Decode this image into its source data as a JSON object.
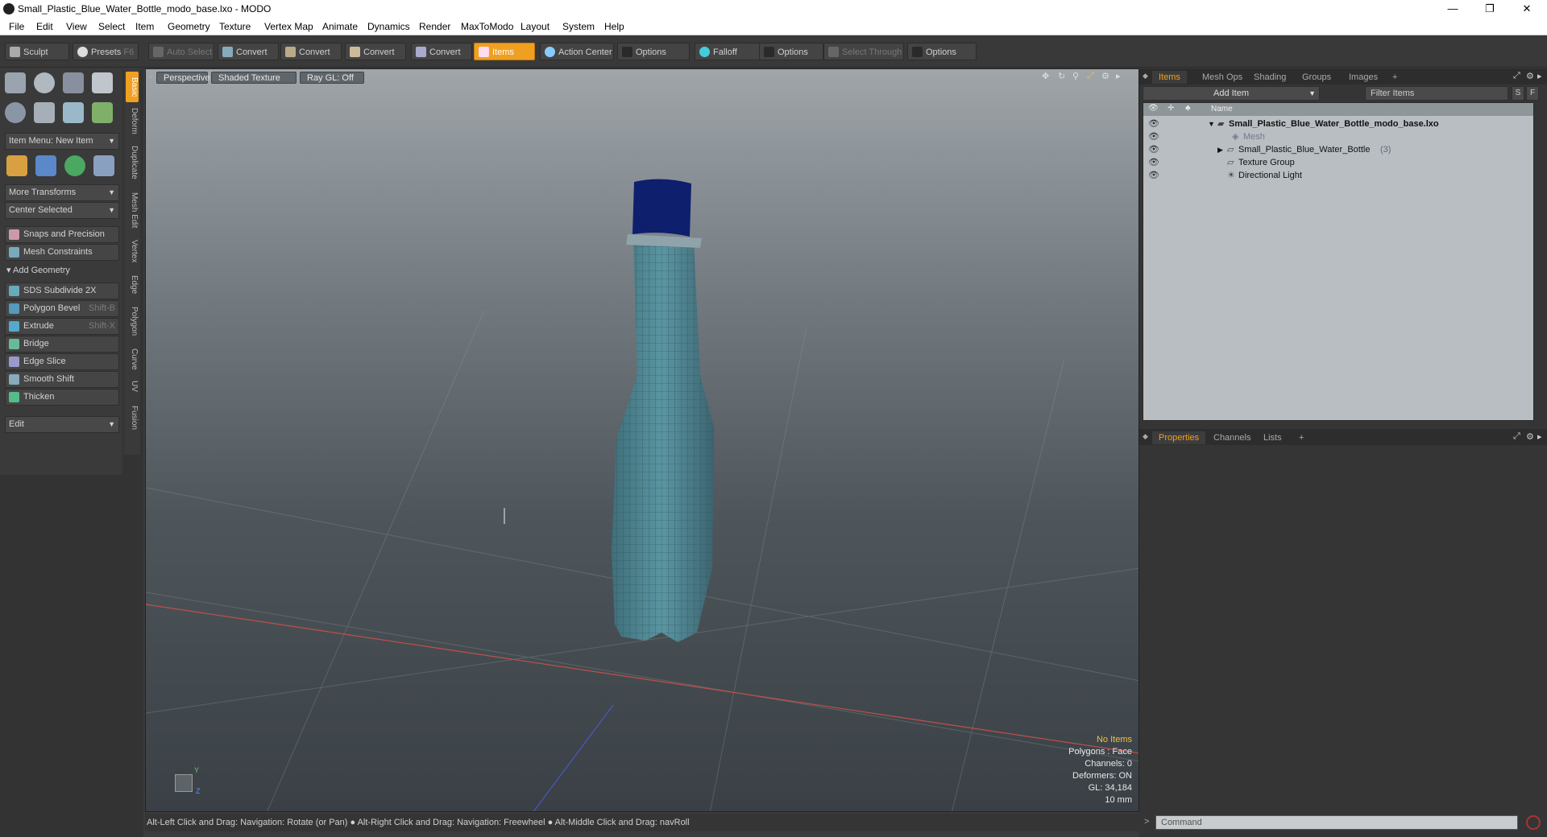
{
  "window": {
    "title": "Small_Plastic_Blue_Water_Bottle_modo_base.lxo - MODO",
    "minimize": "—",
    "restore": "❐",
    "close": "✕"
  },
  "menu": [
    "File",
    "Edit",
    "View",
    "Select",
    "Item",
    "Geometry",
    "Texture",
    "Vertex Map",
    "Animate",
    "Dynamics",
    "Render",
    "MaxToModo",
    "Layout",
    "System",
    "Help"
  ],
  "toolbar": {
    "sculpt": "Sculpt",
    "presets": "Presets",
    "presets_key": "F6",
    "auto_select": "Auto Select",
    "convert": "Convert",
    "items": "Items",
    "action_center": "Action Center",
    "options": "Options",
    "falloff": "Falloff",
    "select_through": "Select Through"
  },
  "left": {
    "item_menu": "Item Menu: New Item",
    "more_transforms": "More Transforms",
    "center_selected": "Center Selected",
    "snaps": "Snaps and Precision",
    "mesh_constraints": "Mesh Constraints",
    "add_geometry": "Add Geometry",
    "tools": [
      {
        "label": "SDS Subdivide 2X",
        "key": ""
      },
      {
        "label": "Polygon Bevel",
        "key": "Shift-B"
      },
      {
        "label": "Extrude",
        "key": "Shift-X"
      },
      {
        "label": "Bridge",
        "key": ""
      },
      {
        "label": "Edge Slice",
        "key": ""
      },
      {
        "label": "Smooth Shift",
        "key": ""
      },
      {
        "label": "Thicken",
        "key": ""
      }
    ],
    "edit": "Edit",
    "vtabs": [
      "Basic",
      "Deform",
      "Duplicate",
      "Mesh Edit",
      "Vertex",
      "Edge",
      "Polygon",
      "Curve",
      "UV",
      "Fusion"
    ]
  },
  "viewport": {
    "perspective": "Perspective",
    "shaded": "Shaded Texture",
    "raygl": "Ray GL: Off",
    "stats": {
      "no_items": "No Items",
      "polygons": "Polygons : Face",
      "channels": "Channels: 0",
      "deformers": "Deformers: ON",
      "gl": "GL: 34,184",
      "scale": "10 mm"
    },
    "axis_y": "Y",
    "axis_z": "Z"
  },
  "status": "Alt-Left Click and Drag: Navigation: Rotate (or Pan) ● Alt-Right Click and Drag: Navigation: Freewheel ● Alt-Middle Click and Drag: navRoll",
  "right": {
    "tabs": [
      "Items",
      "Mesh Ops",
      "Shading",
      "Groups",
      "Images"
    ],
    "add_item": "Add Item",
    "filter": "Filter Items",
    "s_btn": "S",
    "f_btn": "F",
    "col_name": "Name",
    "items": [
      {
        "label": "Small_Plastic_Blue_Water_Bottle_modo_base.lxo",
        "count": ""
      },
      {
        "label": "Mesh",
        "count": ""
      },
      {
        "label": "Small_Plastic_Blue_Water_Bottle",
        "count": "(3)"
      },
      {
        "label": "Texture Group",
        "count": ""
      },
      {
        "label": "Directional Light",
        "count": ""
      }
    ],
    "prop_tabs": [
      "Properties",
      "Channels",
      "Lists"
    ],
    "command": "Command",
    "plus": "+"
  }
}
